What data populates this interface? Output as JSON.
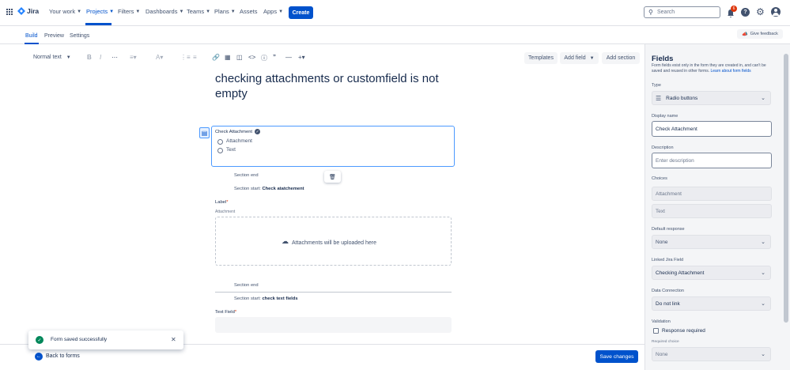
{
  "topbar": {
    "app_name": "Jira",
    "nav": [
      "Your work",
      "Projects",
      "Filters",
      "Dashboards",
      "Teams",
      "Plans",
      "Assets",
      "Apps"
    ],
    "create_label": "Create",
    "search_placeholder": "Search",
    "notifications_count": "6"
  },
  "subtabs": [
    "Build",
    "Preview",
    "Settings"
  ],
  "feedback_label": "Give feedback",
  "toolbar": {
    "text_style": "Normal text",
    "templates_label": "Templates",
    "add_field_label": "Add field",
    "add_section_label": "Add section"
  },
  "form": {
    "title": "checking attachments or customfield is not empty",
    "field_label": "Check Attachment",
    "options": [
      "Attachment",
      "Text"
    ],
    "section1_end": "Section end",
    "section2_start_prefix": "Section start: ",
    "section2_start_name": "Check atatchement",
    "label_title": "Label",
    "attachment_sub": "Attachment",
    "drop_text": "Attachments will be uploaded here",
    "section2_end": "Section end",
    "section3_start_prefix": "Section start: ",
    "section3_start_name": "check text fields",
    "text_field_label": "Text Field"
  },
  "bottombar": {
    "back_label": "Back to forms",
    "save_label": "Save changes"
  },
  "toast": {
    "message": "Form saved successfully"
  },
  "panel": {
    "title": "Fields",
    "description": "Form fields exist only in the form they are created in, and can't be saved and reused in other forms.",
    "learn_more": "Learn about form fields",
    "type_label": "Type",
    "type_value": "Radio buttons",
    "display_name_label": "Display name",
    "display_name_value": "Check Attachment",
    "description_label": "Description",
    "description_placeholder": "Enter description",
    "choices_label": "Choices",
    "choices": [
      "Attachment",
      "Text"
    ],
    "default_response_label": "Default response",
    "default_response_value": "None",
    "linked_field_label": "Linked Jira Field",
    "linked_field_value": "Checking Attachment",
    "data_connection_label": "Data Connection",
    "data_connection_value": "Do not link",
    "validation_label": "Validation",
    "response_required_label": "Response required",
    "required_choice_label": "Required choice",
    "required_choice_value": "None"
  }
}
